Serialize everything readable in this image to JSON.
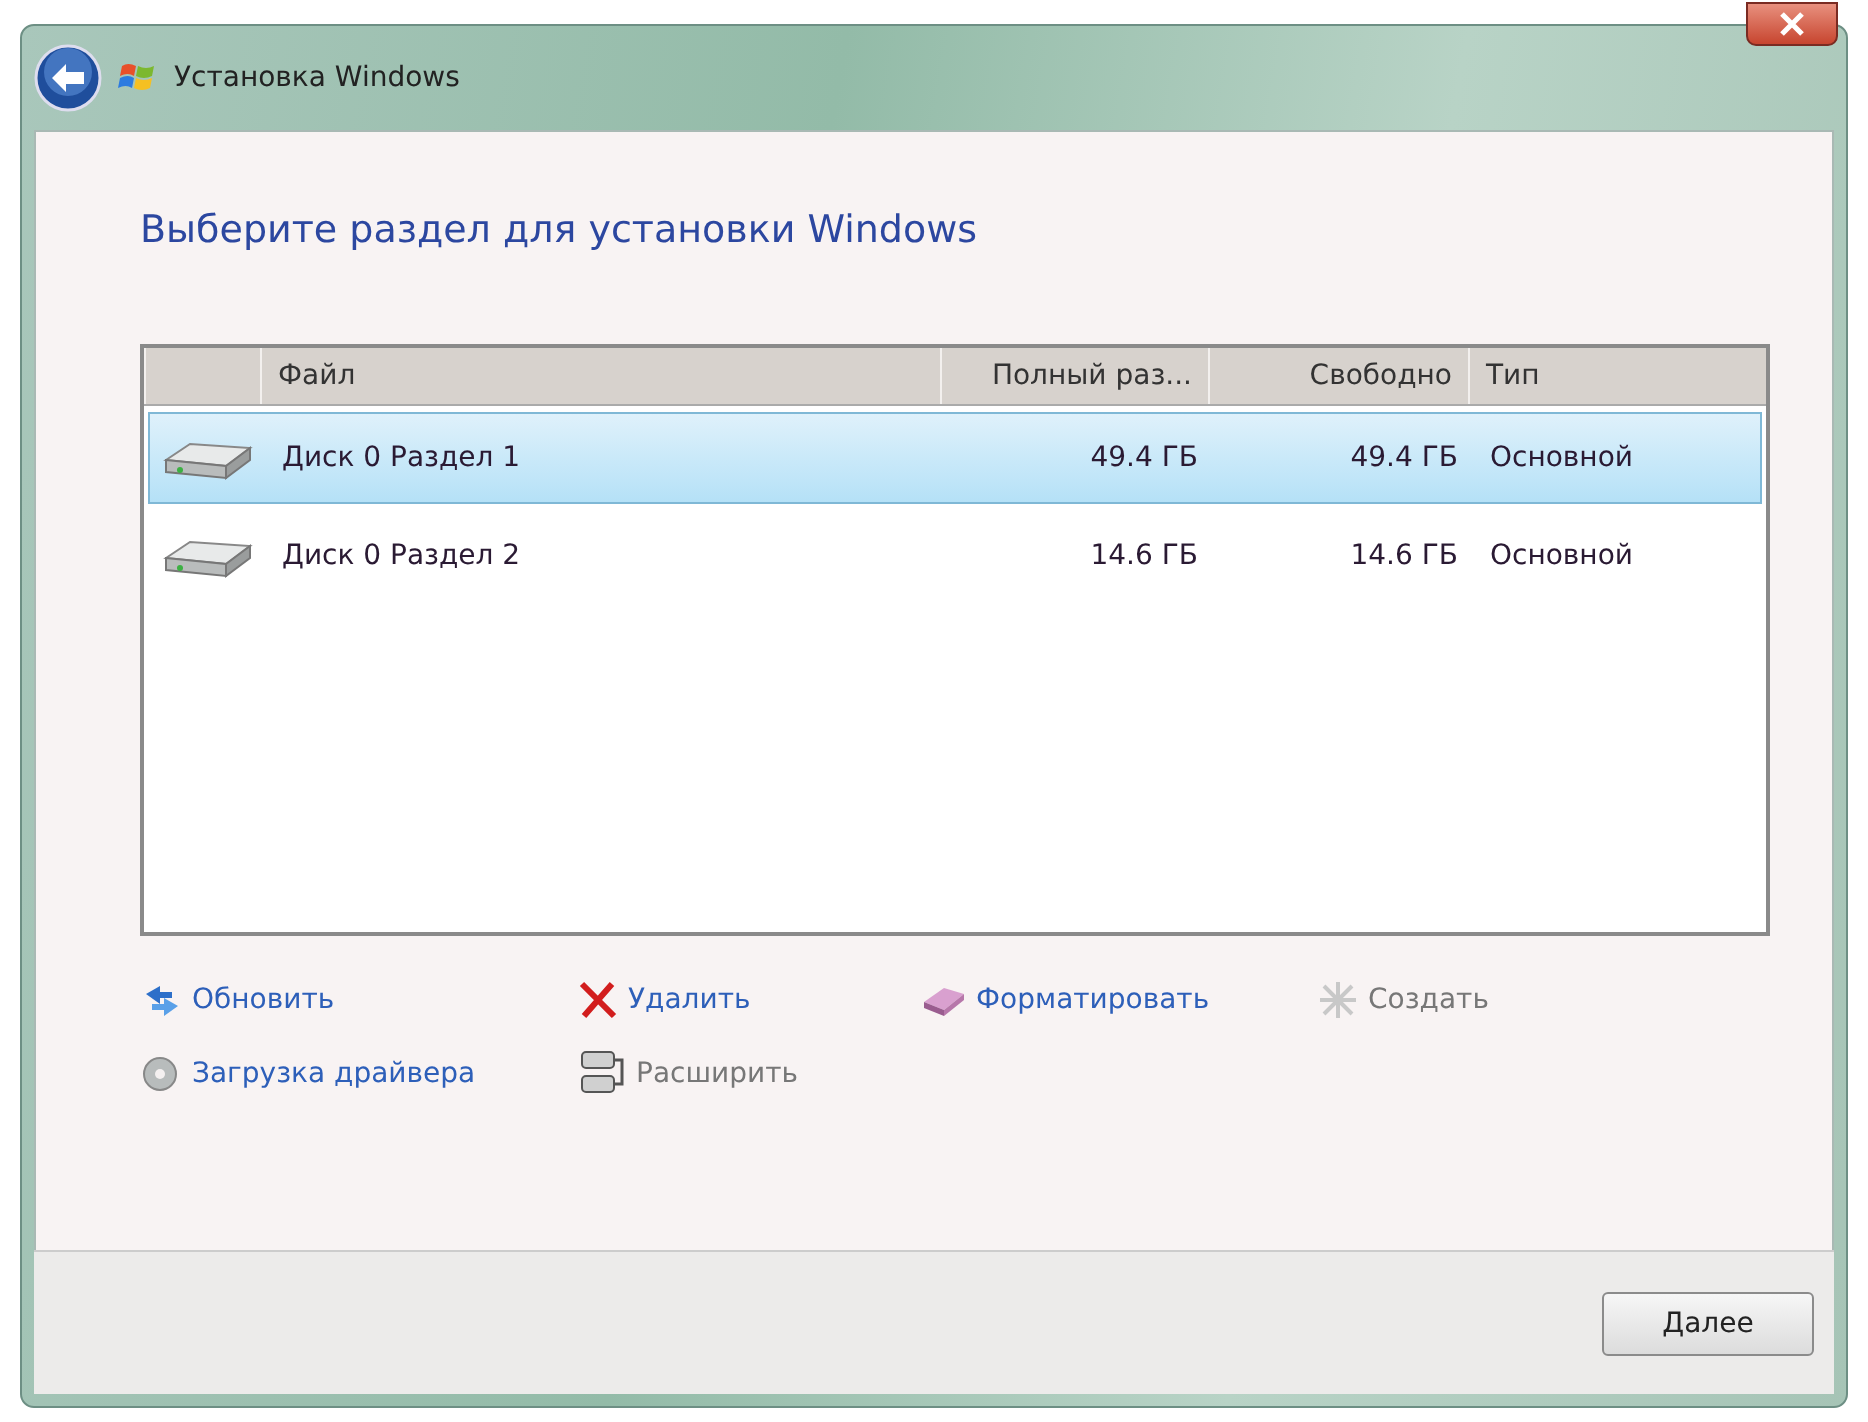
{
  "window": {
    "title": "Установка Windows"
  },
  "heading": "Выберите раздел для установки Windows",
  "table": {
    "columns": [
      "Файл",
      "Полный раз...",
      "Свободно",
      "Тип"
    ],
    "rows": [
      {
        "cells": [
          "Диск 0 Раздел 1",
          "49.4 ГБ",
          "49.4 ГБ",
          "Основной"
        ],
        "selected": true
      },
      {
        "cells": [
          "Диск 0 Раздел 2",
          "14.6 ГБ",
          "14.6 ГБ",
          "Основной"
        ],
        "selected": false
      }
    ]
  },
  "actions": [
    {
      "kind": "refresh",
      "label": "Обновить",
      "disabled": false
    },
    {
      "kind": "delete",
      "label": "Удалить",
      "disabled": false
    },
    {
      "kind": "format",
      "label": "Форматировать",
      "disabled": false
    },
    {
      "kind": "new",
      "label": "Создать",
      "disabled": true
    },
    {
      "kind": "driver",
      "label": "Загрузка драйвера",
      "disabled": false
    },
    {
      "kind": "extend",
      "label": "Расширить",
      "disabled": true
    }
  ],
  "buttons": [
    "Далее"
  ]
}
